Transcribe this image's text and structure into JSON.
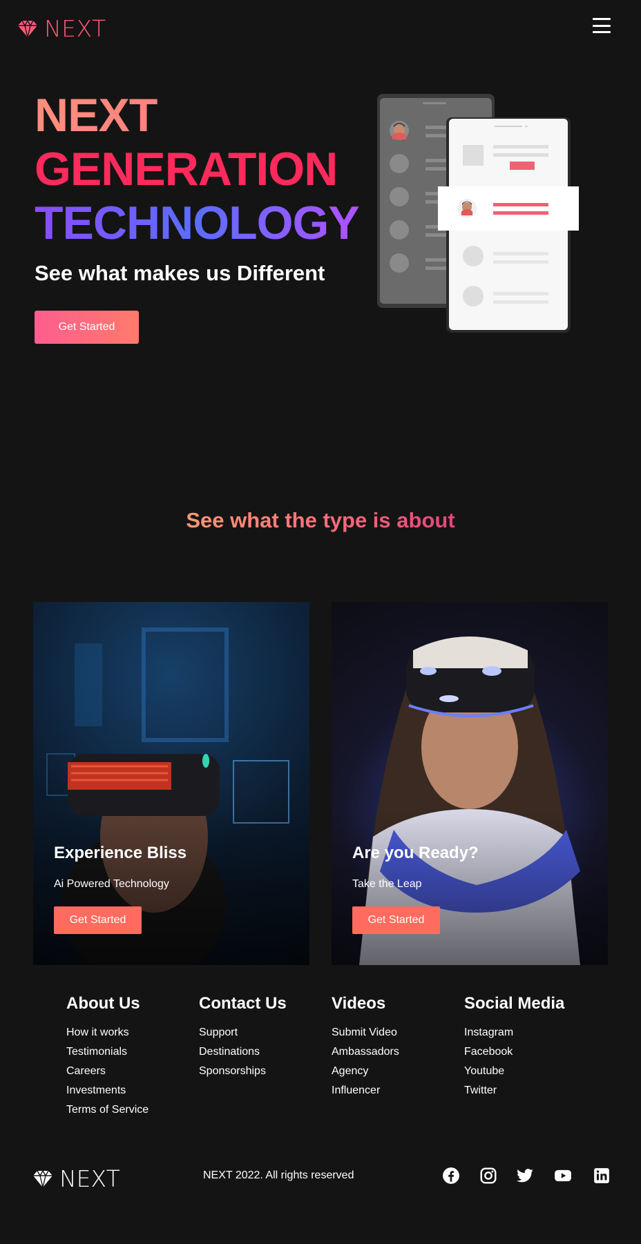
{
  "nav": {
    "brand": "NEXT",
    "logo_icon": "diamond-logo-icon",
    "menu_icon": "hamburger-menu-icon"
  },
  "hero": {
    "line1": "NEXT",
    "line2": "GENERATION",
    "line3": "TECHNOLOGY",
    "subtitle": "See what makes us Different",
    "cta": "Get Started"
  },
  "section": {
    "title": "See what the type is about"
  },
  "cards": [
    {
      "title": "Experience Bliss",
      "subtitle": "Ai Powered Technology",
      "cta": "Get Started"
    },
    {
      "title": "Are you Ready?",
      "subtitle": "Take the Leap",
      "cta": "Get Started"
    }
  ],
  "footer": {
    "columns": [
      {
        "heading": "About Us",
        "links": [
          "How it works",
          "Testimonials",
          "Careers",
          "Investments",
          "Terms of Service"
        ]
      },
      {
        "heading": "Contact Us",
        "links": [
          "Support",
          "Destinations",
          "Sponsorships"
        ]
      },
      {
        "heading": "Videos",
        "links": [
          "Submit Video",
          "Ambassadors",
          "Agency",
          "Influencer"
        ]
      },
      {
        "heading": "Social Media",
        "links": [
          "Instagram",
          "Facebook",
          "Youtube",
          "Twitter"
        ]
      }
    ],
    "brand": "NEXT",
    "copyright": "NEXT 2022. All rights reserved",
    "social_icons": [
      "facebook-icon",
      "instagram-icon",
      "twitter-icon",
      "youtube-icon",
      "linkedin-icon"
    ]
  },
  "colors": {
    "background": "#141414",
    "accent": "#ff6b5e",
    "brand": "#ff5a7a"
  }
}
